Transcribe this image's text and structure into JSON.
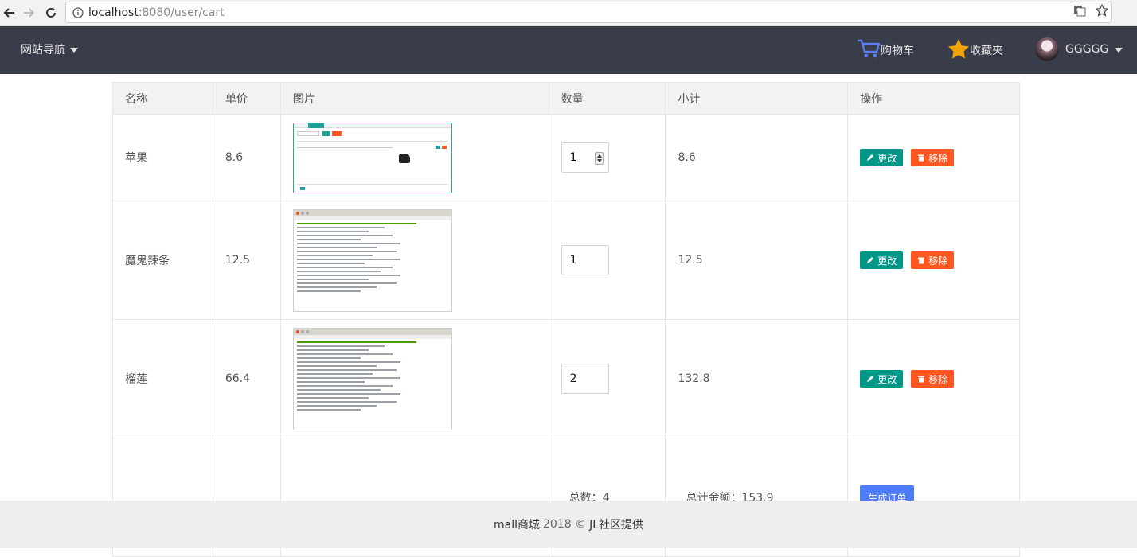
{
  "browser": {
    "url_host": "localhost",
    "url_rest": ":8080/user/cart"
  },
  "topnav": {
    "site_nav_label": "网站导航",
    "cart_label": "购物车",
    "favorites_label": "收藏夹",
    "username": "GGGGG",
    "colors": {
      "bar": "#393d49",
      "cart_icon": "#5b7cf6",
      "star_icon": "#f0a30a"
    }
  },
  "table": {
    "headers": [
      "名称",
      "单价",
      "图片",
      "数量",
      "小计",
      "操作"
    ],
    "rows": [
      {
        "name": "苹果",
        "price": "8.6",
        "qty": "1",
        "subtotal": "8.6",
        "edit": "更改",
        "remove": "移除"
      },
      {
        "name": "魔鬼辣条",
        "price": "12.5",
        "qty": "1",
        "subtotal": "12.5",
        "edit": "更改",
        "remove": "移除"
      },
      {
        "name": "榴莲",
        "price": "66.4",
        "qty": "2",
        "subtotal": "132.8",
        "edit": "更改",
        "remove": "移除"
      }
    ],
    "total_count": "总数：4",
    "total_amount": "总计金额：153.9",
    "order_button": "生成订单"
  },
  "footer": {
    "brand": "mall商城",
    "year": "2018 ©",
    "provider": "JL社区提供"
  }
}
